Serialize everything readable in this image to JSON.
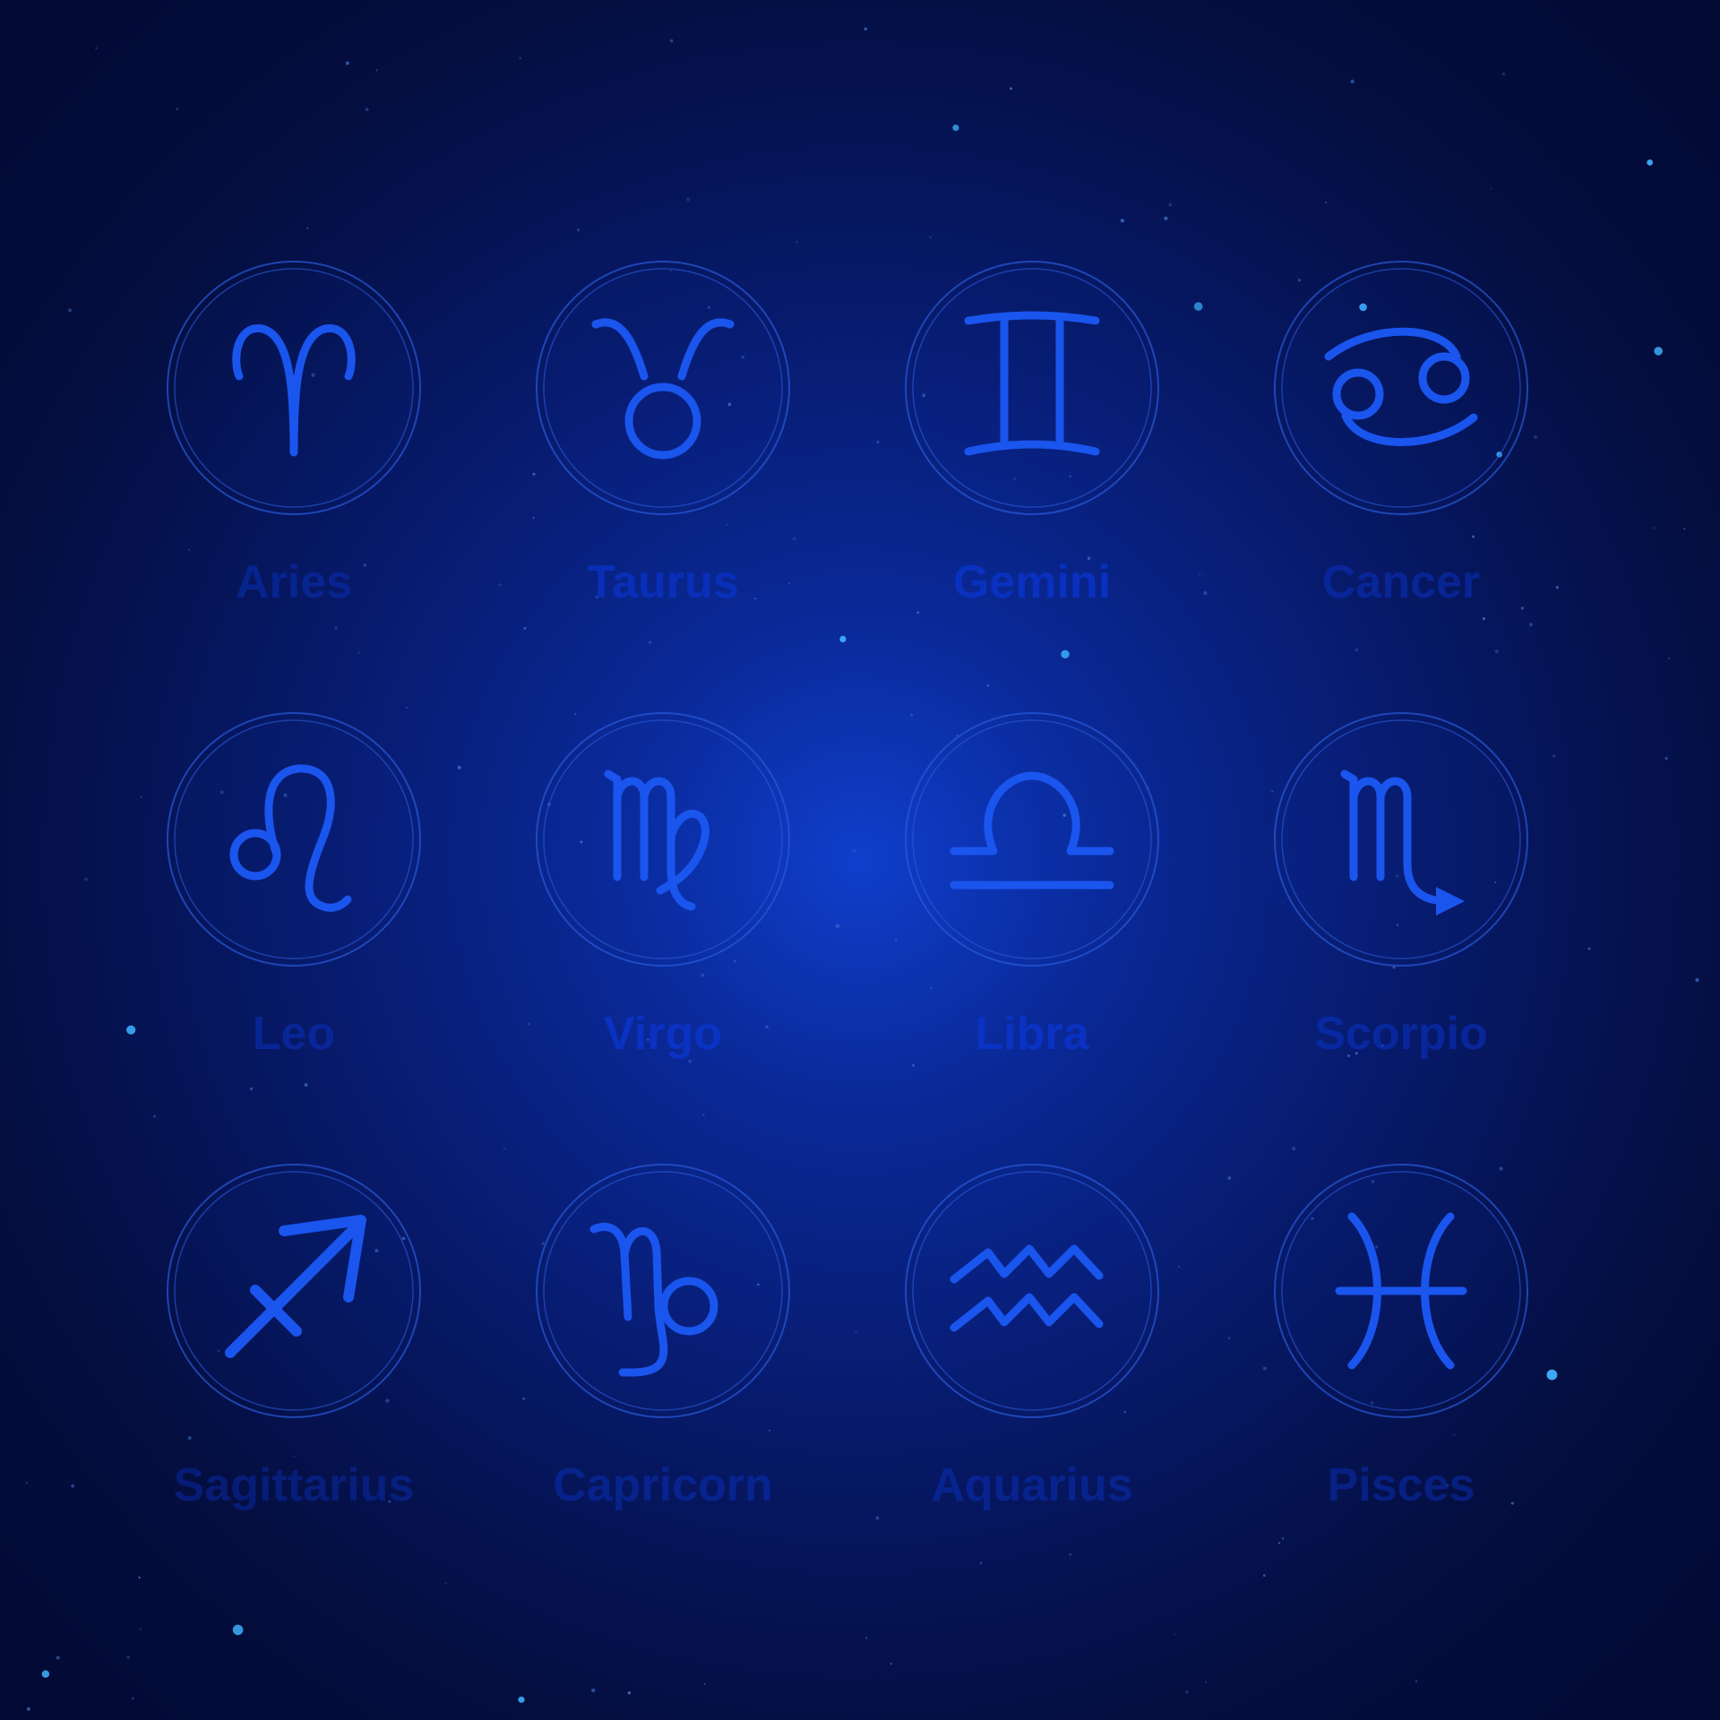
{
  "colors": {
    "glyph": "#1a55ee",
    "ring": "#2a5ad8",
    "label": "#0a33c8"
  },
  "signs": [
    {
      "name": "Aries",
      "icon": "aries-icon",
      "label_opacity": 0.45
    },
    {
      "name": "Taurus",
      "icon": "taurus-icon",
      "label_opacity": 0.75
    },
    {
      "name": "Gemini",
      "icon": "gemini-icon",
      "label_opacity": 0.85
    },
    {
      "name": "Cancer",
      "icon": "cancer-icon",
      "label_opacity": 0.5
    },
    {
      "name": "Leo",
      "icon": "leo-icon",
      "label_opacity": 0.5
    },
    {
      "name": "Virgo",
      "icon": "virgo-icon",
      "label_opacity": 0.9
    },
    {
      "name": "Libra",
      "icon": "libra-icon",
      "label_opacity": 0.9
    },
    {
      "name": "Scorpio",
      "icon": "scorpio-icon",
      "label_opacity": 0.55
    },
    {
      "name": "Sagittarius",
      "icon": "sagittarius-icon",
      "label_opacity": 0.4
    },
    {
      "name": "Capricorn",
      "icon": "capricorn-icon",
      "label_opacity": 0.45
    },
    {
      "name": "Aquarius",
      "icon": "aquarius-icon",
      "label_opacity": 0.45
    },
    {
      "name": "Pisces",
      "icon": "pisces-icon",
      "label_opacity": 0.45
    }
  ]
}
